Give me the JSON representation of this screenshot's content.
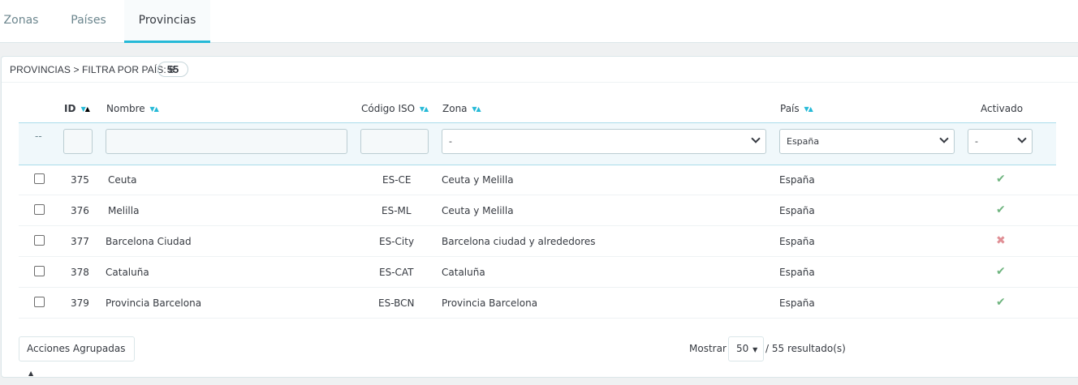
{
  "tabs": [
    {
      "label": "Zonas",
      "active": false
    },
    {
      "label": "Países",
      "active": false
    },
    {
      "label": "Provincias",
      "active": true
    }
  ],
  "panel": {
    "title": "Provincias > Filtra por país: 6",
    "count": "55"
  },
  "columns": {
    "id": "ID",
    "name": "Nombre",
    "iso": "Código ISO",
    "zone": "Zona",
    "country": "País",
    "active": "Activado"
  },
  "filters": {
    "bulk_placeholder": "--",
    "zone_value": "-",
    "country_value": "España",
    "active_value": "-"
  },
  "rows": [
    {
      "id": "375",
      "name": "Ceuta",
      "iso": "ES-CE",
      "zone": "Ceuta y Melilla",
      "country": "España",
      "active": true
    },
    {
      "id": "376",
      "name": "Melilla",
      "iso": "ES-ML",
      "zone": "Ceuta y Melilla",
      "country": "España",
      "active": true
    },
    {
      "id": "377",
      "name": "Barcelona Ciudad",
      "iso": "ES-City",
      "zone": "Barcelona ciudad y alrededores",
      "country": "España",
      "active": false
    },
    {
      "id": "378",
      "name": "Cataluña",
      "iso": "ES-CAT",
      "zone": "Cataluña",
      "country": "España",
      "active": true
    },
    {
      "id": "379",
      "name": "Provincia Barcelona",
      "iso": "ES-BCN",
      "zone": "Provincia Barcelona",
      "country": "España",
      "active": true
    }
  ],
  "footer": {
    "bulk_actions": "Acciones Agrupadas",
    "show_label": "Mostrar",
    "per_page": "50",
    "results": "/ 55 resultado(s)"
  },
  "icons": {
    "active_true": "check-icon",
    "active_false": "cross-icon"
  },
  "colors": {
    "accent": "#25b9d7",
    "enabled": "#70b580",
    "disabled": "#e08f95"
  }
}
